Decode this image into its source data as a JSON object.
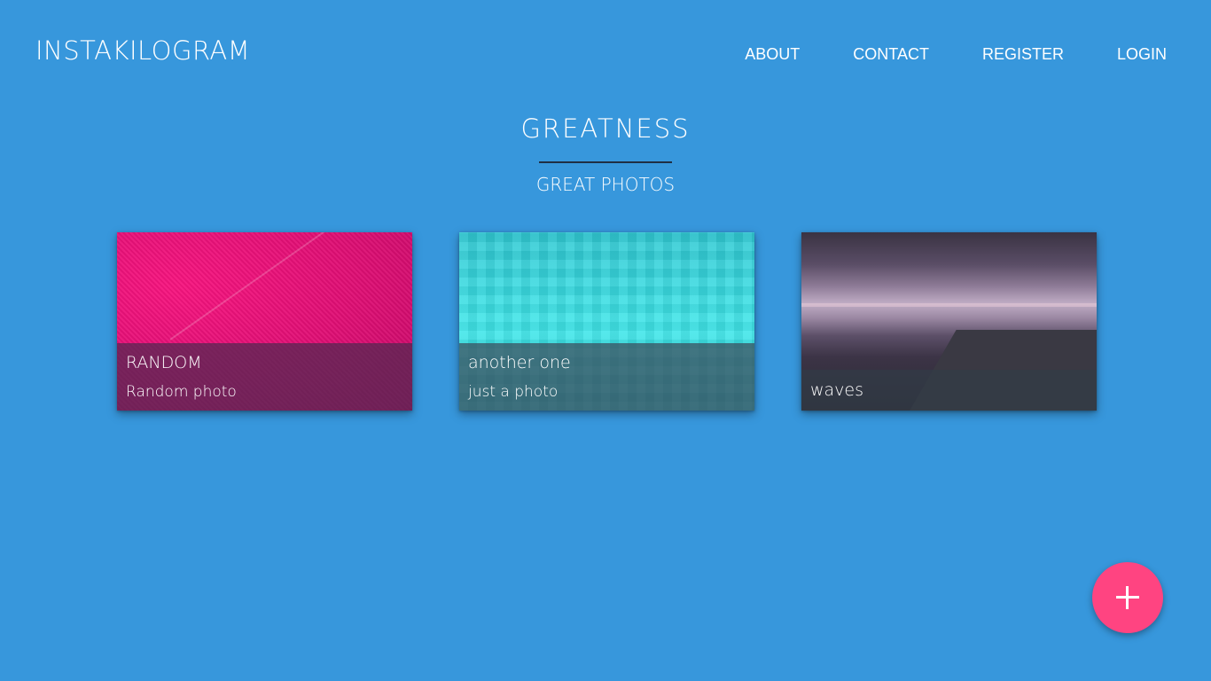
{
  "header": {
    "brand": "INSTAKILOGRAM",
    "nav": [
      "ABOUT",
      "CONTACT",
      "REGISTER",
      "LOGIN"
    ]
  },
  "hero": {
    "title": "GREATNESS",
    "subtitle": "GREAT PHOTOS"
  },
  "gallery": {
    "items": [
      {
        "title": "RANDOM",
        "subtitle": "Random photo",
        "image": "pink-fabric-photo"
      },
      {
        "title": "another one",
        "subtitle": "just a photo",
        "image": "teal-geometric-photo"
      },
      {
        "title": "waves",
        "subtitle": "",
        "image": "beach-sunset-photo"
      }
    ]
  },
  "fab": {
    "icon": "plus-icon",
    "color": "#ff4481"
  },
  "colors": {
    "background": "#3797dc",
    "text": "#ffffff",
    "rule": "#1f2f44"
  }
}
